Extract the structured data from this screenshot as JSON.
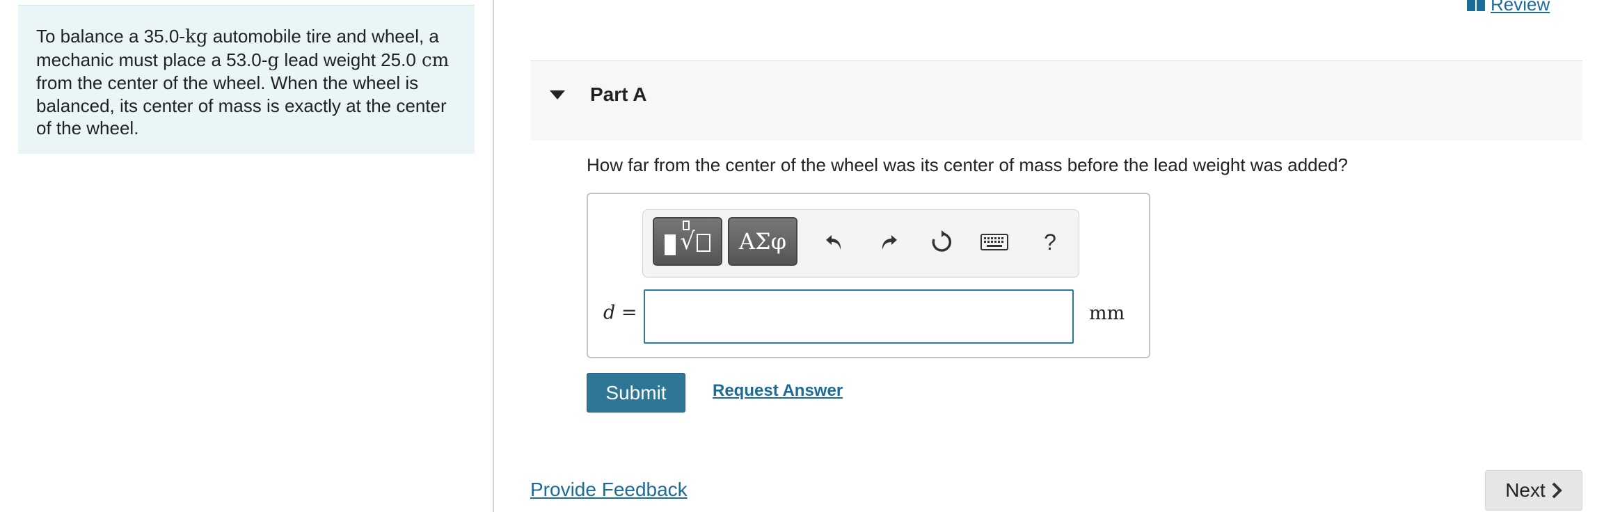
{
  "problem": {
    "p1": "To balance a ",
    "mass_value": "35.0",
    "mass_unit": "-kg",
    "p2": " automobile tire and wheel, a mechanic must place a ",
    "weight_value": "53.0",
    "weight_unit": "-g",
    "p3": " lead weight ",
    "dist_value": "25.0",
    "dist_unit": " cm",
    "p4": " from the center of the wheel. When the wheel is balanced, its center of mass is exactly at the center of the wheel."
  },
  "header": {
    "review_label": "Review"
  },
  "part": {
    "title": "Part A",
    "question": "How far from the center of the wheel was its center of mass before the lead weight was added?"
  },
  "toolbar": {
    "greek_label": "ΑΣφ",
    "help_label": "?",
    "icons": [
      "templates-icon",
      "greek-letters-icon",
      "undo-icon",
      "redo-icon",
      "reset-icon",
      "keyboard-icon",
      "help-icon"
    ]
  },
  "answer": {
    "variable": "d",
    "equals": " =",
    "value": "",
    "unit": "mm"
  },
  "actions": {
    "submit_label": "Submit",
    "request_answer_label": "Request Answer"
  },
  "footer": {
    "feedback_label": "Provide Feedback",
    "next_label": "Next"
  },
  "colors": {
    "accent": "#2f7596",
    "link": "#1b6c97",
    "problem_bg": "#e9f5f7"
  }
}
